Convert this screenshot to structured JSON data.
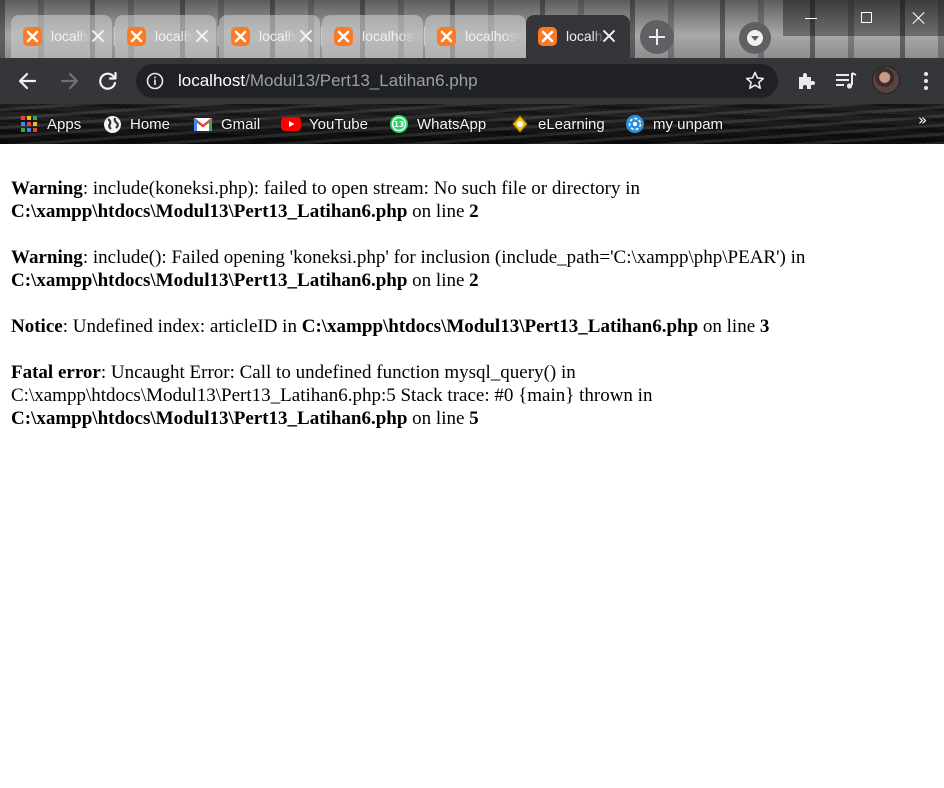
{
  "tabs": [
    {
      "label": "localhost"
    },
    {
      "label": "localhost"
    },
    {
      "label": "localhost"
    },
    {
      "label": "localhost"
    },
    {
      "label": "localhost"
    },
    {
      "label": "localhost",
      "active": true
    }
  ],
  "toolbar": {
    "url_host": "localhost",
    "url_path": "/Modul13/Pert13_Latihan6.php"
  },
  "bookmarks": [
    {
      "label": "Apps",
      "icon": "apps-grid-icon"
    },
    {
      "label": "Home",
      "icon": "globe-icon"
    },
    {
      "label": "Gmail",
      "icon": "gmail-icon"
    },
    {
      "label": "YouTube",
      "icon": "youtube-icon"
    },
    {
      "label": "WhatsApp",
      "icon": "whatsapp-icon"
    },
    {
      "label": "eLearning",
      "icon": "elearning-icon"
    },
    {
      "label": "my unpam",
      "icon": "unpam-icon"
    }
  ],
  "bookmarks_overflow": "»",
  "errors": [
    {
      "type": "Warning",
      "message": ": include(koneksi.php): failed to open stream: No such file or directory in ",
      "file": "C:\\xampp\\htdocs\\Modul13\\Pert13_Latihan6.php",
      "on_line": " on line ",
      "line": "2"
    },
    {
      "type": "Warning",
      "message": ": include(): Failed opening 'koneksi.php' for inclusion (include_path='C:\\xampp\\php\\PEAR') in ",
      "file": "C:\\xampp\\htdocs\\Modul13\\Pert13_Latihan6.php",
      "on_line": " on line ",
      "line": "2"
    },
    {
      "type": "Notice",
      "message": ": Undefined index: articleID in ",
      "file": "C:\\xampp\\htdocs\\Modul13\\Pert13_Latihan6.php",
      "on_line": " on line ",
      "line": "3"
    },
    {
      "type": "Fatal error",
      "message": ": Uncaught Error: Call to undefined function mysql_query() in C:\\xampp\\htdocs\\Modul13\\Pert13_Latihan6.php:5 Stack trace: #0 {main} thrown in ",
      "file": "C:\\xampp\\htdocs\\Modul13\\Pert13_Latihan6.php",
      "on_line": " on line ",
      "line": "5"
    }
  ],
  "colors": {
    "toolbar_bg": "#35363a",
    "omnibox_bg": "#202124",
    "xampp_orange": "#fb7a24"
  }
}
